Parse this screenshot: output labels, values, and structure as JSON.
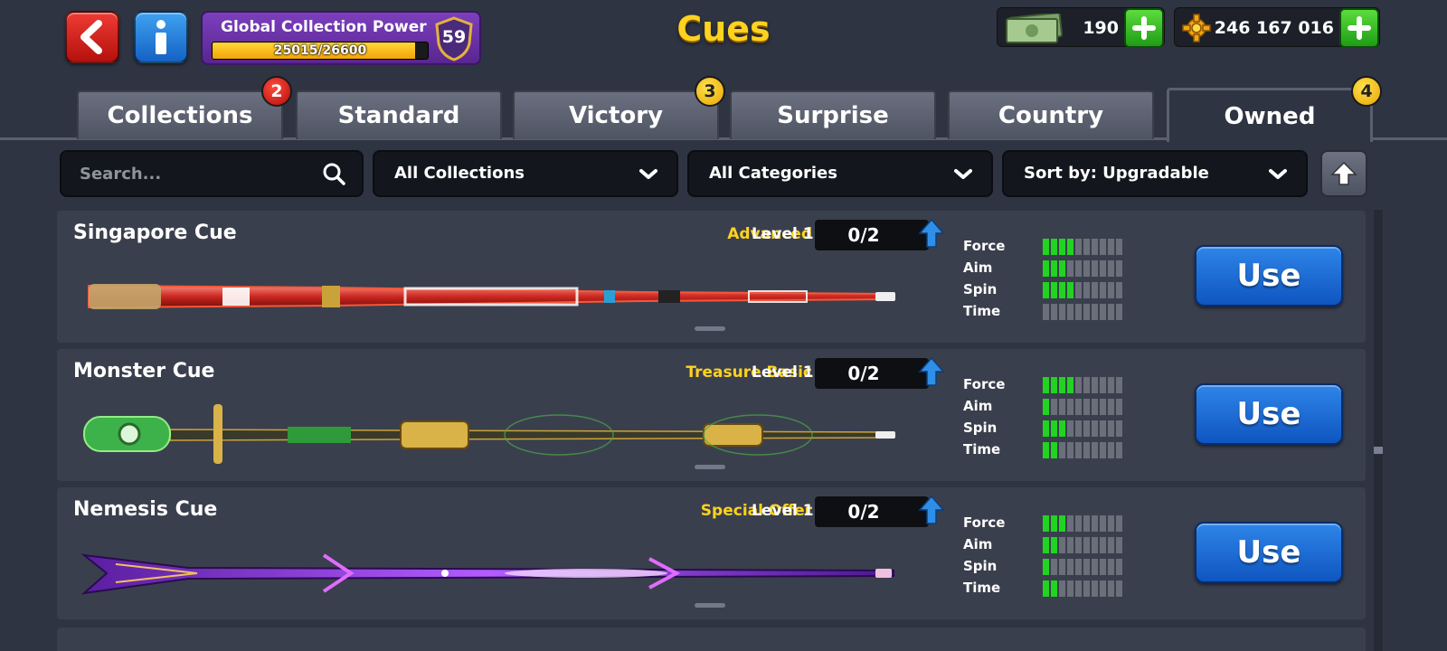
{
  "header": {
    "title": "Cues",
    "global_collection_power": {
      "label": "Global Collection Power",
      "current": 25015,
      "max": 26600,
      "value_text": "25015/26600",
      "level": "59"
    },
    "cash": {
      "value": "190",
      "icon": "cash-icon"
    },
    "coins": {
      "value": "246 167 016",
      "icon": "coin-gear-icon"
    }
  },
  "tabs": [
    {
      "label": "Collections",
      "badge": "2",
      "badge_color": "red"
    },
    {
      "label": "Standard",
      "badge": ""
    },
    {
      "label": "Victory",
      "badge": "3",
      "badge_color": "yellow"
    },
    {
      "label": "Surprise",
      "badge": ""
    },
    {
      "label": "Country",
      "badge": ""
    },
    {
      "label": "Owned",
      "badge": "4",
      "badge_color": "yellow",
      "active": true
    }
  ],
  "filters": {
    "search_placeholder": "Search...",
    "collections": "All Collections",
    "categories": "All Categories",
    "sort": "Sort by: Upgradable"
  },
  "stat_labels": [
    "Force",
    "Aim",
    "Spin",
    "Time"
  ],
  "cues": [
    {
      "name": "Singapore Cue",
      "category": "Advanced",
      "level": "Level 1",
      "progress": "0/2",
      "stats": {
        "force": 4,
        "aim": 3,
        "spin": 4,
        "time": 0
      },
      "use_label": "Use"
    },
    {
      "name": "Monster Cue",
      "category": "Treasure Basic",
      "level": "Level 1",
      "progress": "0/2",
      "stats": {
        "force": 4,
        "aim": 1,
        "spin": 3,
        "time": 2
      },
      "use_label": "Use"
    },
    {
      "name": "Nemesis Cue",
      "category": "Special Offer",
      "level": "Level 1",
      "progress": "0/2",
      "stats": {
        "force": 3,
        "aim": 2,
        "spin": 1,
        "time": 2
      },
      "use_label": "Use"
    }
  ],
  "colors": {
    "background": "#2f3442",
    "card": "#3a3f4d",
    "title_yellow": "#ffd21f",
    "stat_on": "#22d322",
    "stat_off": "#6a6f7a",
    "use_button": "#1e6fd8"
  }
}
